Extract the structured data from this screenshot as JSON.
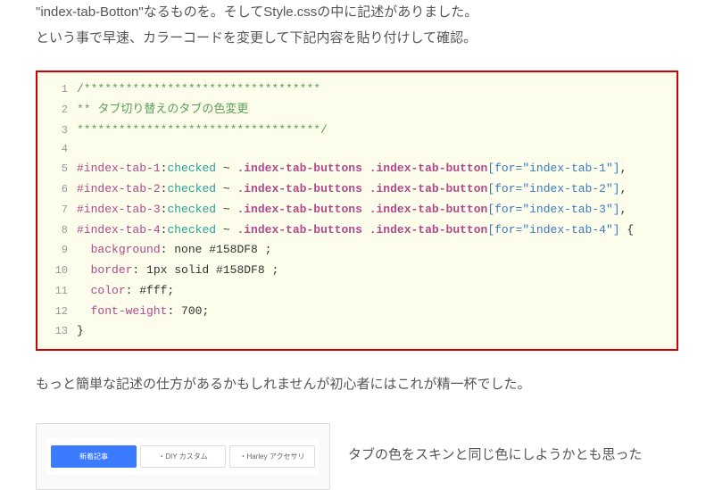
{
  "intro": {
    "line1": "\"index-tab-Botton\"なるものを。そしてStyle.cssの中に記述がありました。",
    "line2": "という事で早速、カラーコードを変更して下記内容を貼り付けして確認。"
  },
  "code": {
    "lines": [
      {
        "n": "1",
        "tokens": [
          {
            "cls": "c-comment",
            "t": "/**********************************"
          }
        ]
      },
      {
        "n": "2",
        "tokens": [
          {
            "cls": "c-comment",
            "t": "** タブ切り替えのタブの色変更"
          }
        ]
      },
      {
        "n": "3",
        "tokens": [
          {
            "cls": "c-comment",
            "t": "***********************************/"
          }
        ]
      },
      {
        "n": "4",
        "tokens": [
          {
            "cls": "c-plain",
            "t": ""
          }
        ]
      },
      {
        "n": "5",
        "tokens": [
          {
            "cls": "c-sel",
            "t": "#index-tab-1"
          },
          {
            "cls": "c-punc",
            "t": ":"
          },
          {
            "cls": "c-pseudo",
            "t": "checked"
          },
          {
            "cls": "c-punc",
            "t": " ~ "
          },
          {
            "cls": "c-class",
            "t": ".index-tab-buttons"
          },
          {
            "cls": "c-punc",
            "t": " "
          },
          {
            "cls": "c-class",
            "t": ".index-tab-button"
          },
          {
            "cls": "c-attr",
            "t": "[for=\"index-tab-1\"]"
          },
          {
            "cls": "c-punc",
            "t": ","
          }
        ]
      },
      {
        "n": "6",
        "tokens": [
          {
            "cls": "c-sel",
            "t": "#index-tab-2"
          },
          {
            "cls": "c-punc",
            "t": ":"
          },
          {
            "cls": "c-pseudo",
            "t": "checked"
          },
          {
            "cls": "c-punc",
            "t": " ~ "
          },
          {
            "cls": "c-class",
            "t": ".index-tab-buttons"
          },
          {
            "cls": "c-punc",
            "t": " "
          },
          {
            "cls": "c-class",
            "t": ".index-tab-button"
          },
          {
            "cls": "c-attr",
            "t": "[for=\"index-tab-2\"]"
          },
          {
            "cls": "c-punc",
            "t": ","
          }
        ]
      },
      {
        "n": "7",
        "tokens": [
          {
            "cls": "c-sel",
            "t": "#index-tab-3"
          },
          {
            "cls": "c-punc",
            "t": ":"
          },
          {
            "cls": "c-pseudo",
            "t": "checked"
          },
          {
            "cls": "c-punc",
            "t": " ~ "
          },
          {
            "cls": "c-class",
            "t": ".index-tab-buttons"
          },
          {
            "cls": "c-punc",
            "t": " "
          },
          {
            "cls": "c-class",
            "t": ".index-tab-button"
          },
          {
            "cls": "c-attr",
            "t": "[for=\"index-tab-3\"]"
          },
          {
            "cls": "c-punc",
            "t": ","
          }
        ]
      },
      {
        "n": "8",
        "tokens": [
          {
            "cls": "c-sel",
            "t": "#index-tab-4"
          },
          {
            "cls": "c-punc",
            "t": ":"
          },
          {
            "cls": "c-pseudo",
            "t": "checked"
          },
          {
            "cls": "c-punc",
            "t": " ~ "
          },
          {
            "cls": "c-class",
            "t": ".index-tab-buttons"
          },
          {
            "cls": "c-punc",
            "t": " "
          },
          {
            "cls": "c-class",
            "t": ".index-tab-button"
          },
          {
            "cls": "c-attr",
            "t": "[for=\"index-tab-4\"]"
          },
          {
            "cls": "c-punc",
            "t": " {"
          }
        ]
      },
      {
        "n": "9",
        "tokens": [
          {
            "cls": "c-plain",
            "t": "  "
          },
          {
            "cls": "c-prop",
            "t": "background"
          },
          {
            "cls": "c-punc",
            "t": ": none #158DF8 ;"
          }
        ]
      },
      {
        "n": "10",
        "tokens": [
          {
            "cls": "c-plain",
            "t": "  "
          },
          {
            "cls": "c-prop",
            "t": "border"
          },
          {
            "cls": "c-punc",
            "t": ": 1px solid #158DF8 ;"
          }
        ]
      },
      {
        "n": "11",
        "tokens": [
          {
            "cls": "c-plain",
            "t": "  "
          },
          {
            "cls": "c-prop",
            "t": "color"
          },
          {
            "cls": "c-punc",
            "t": ": #fff;"
          }
        ]
      },
      {
        "n": "12",
        "tokens": [
          {
            "cls": "c-plain",
            "t": "  "
          },
          {
            "cls": "c-prop",
            "t": "font-weight"
          },
          {
            "cls": "c-punc",
            "t": ": 700;"
          }
        ]
      },
      {
        "n": "13",
        "tokens": [
          {
            "cls": "c-punc",
            "t": "}"
          }
        ]
      }
    ]
  },
  "outro": {
    "line1": "もっと簡単な記述の仕方があるかもしれませんが初心者にはこれが精一杯でした。"
  },
  "preview": {
    "tabs": [
      {
        "label": "新着記事",
        "active": true
      },
      {
        "label": "・DIY カスタム",
        "active": false
      },
      {
        "label": "・Harley アクセサリ",
        "active": false
      }
    ]
  },
  "after": {
    "text": "タブの色をスキンと同じ色にしようかとも思った"
  }
}
